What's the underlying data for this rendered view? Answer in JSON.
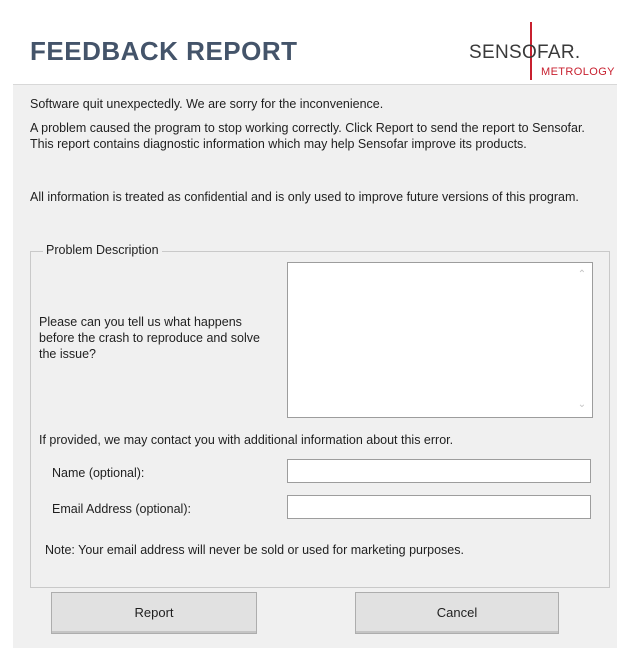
{
  "header": {
    "title": "FEEDBACK REPORT",
    "logo_main": "SENSOFAR.",
    "logo_sub": "METROLOGY"
  },
  "messages": {
    "line1": "Software quit unexpectedly. We are sorry for the inconvenience.",
    "line2": "A problem caused the program to stop working correctly. Click Report to send the report to Sensofar. This report contains diagnostic information which may help Sensofar improve its products.",
    "line3": "All information is treated as confidential and is only used to improve future versions of this program."
  },
  "problem": {
    "legend": "Problem Description",
    "prompt": "Please can you tell us what happens before the crash to reproduce and solve the issue?",
    "description_value": "",
    "contact_note": "If provided, we may contact you with additional information about this error.",
    "name_label": "Name (optional):",
    "name_value": "",
    "email_label": "Email Address (optional):",
    "email_value": "",
    "privacy_note": "Note: Your email address will never be sold or used for marketing purposes."
  },
  "buttons": {
    "report": "Report",
    "cancel": "Cancel"
  },
  "colors": {
    "title": "#44546a",
    "logo_accent": "#c8202f",
    "dialog_bg": "#f0f0f0"
  }
}
